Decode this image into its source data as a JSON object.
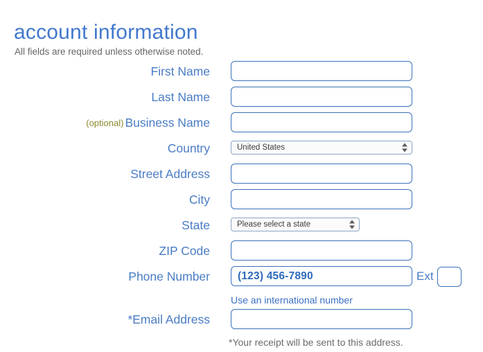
{
  "header": {
    "title": "account information",
    "subtitle": "All fields are required unless otherwise noted."
  },
  "form": {
    "fields": {
      "first_name": {
        "label": "First Name",
        "value": "",
        "placeholder": ""
      },
      "last_name": {
        "label": "Last Name",
        "value": "",
        "placeholder": ""
      },
      "business_name": {
        "label": "Business Name",
        "optional_tag": "(optional)",
        "value": "",
        "placeholder": ""
      },
      "country": {
        "label": "Country",
        "selected": "United States"
      },
      "street_address": {
        "label": "Street Address",
        "value": "",
        "placeholder": ""
      },
      "city": {
        "label": "City",
        "value": "",
        "placeholder": ""
      },
      "state": {
        "label": "State",
        "selected": "Please select a state"
      },
      "zip_code": {
        "label": "ZIP Code",
        "value": "",
        "placeholder": ""
      },
      "phone_number": {
        "label": "Phone Number",
        "value": "",
        "placeholder": "(123) 456-7890"
      },
      "ext": {
        "label": "Ext",
        "value": "",
        "placeholder": ""
      },
      "email_address": {
        "label": "*Email Address",
        "value": "",
        "placeholder": ""
      }
    },
    "hints": {
      "international_number_link": "Use an international number",
      "email_receipt_note": "*Your receipt will be sent to this address."
    }
  },
  "colors": {
    "heading_blue": "#4278cd",
    "label_blue": "#4a7cc4",
    "input_border_blue": "#3a72b8",
    "optional_olive": "#8a8a2f",
    "muted_gray": "#666666",
    "link_blue": "#3b6fc0",
    "select_border": "#8ba6c4"
  }
}
